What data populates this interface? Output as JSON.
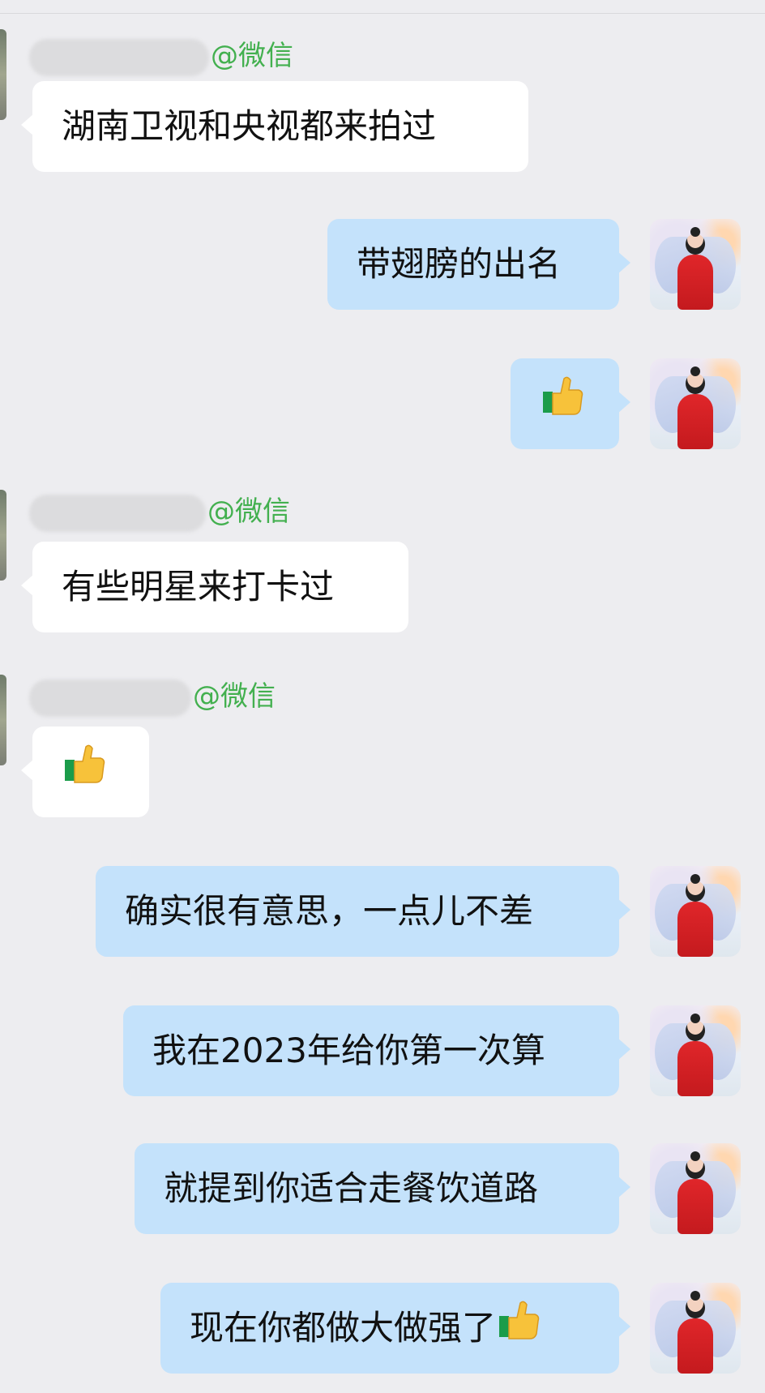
{
  "brand_color": "#43b04f",
  "bubble_colors": {
    "incoming": "#ffffff",
    "outgoing": "#c4e2fb"
  },
  "messages": [
    {
      "side": "left",
      "sender_suffix": "@微信",
      "text": "湖南卫视和央视都来拍过"
    },
    {
      "side": "right",
      "text": "带翅膀的出名"
    },
    {
      "side": "right",
      "emoji": "thumbs-up-icon"
    },
    {
      "side": "left",
      "sender_suffix": "@微信",
      "text": "有些明星来打卡过"
    },
    {
      "side": "left",
      "sender_suffix": "@微信",
      "emoji": "thumbs-up-icon"
    },
    {
      "side": "right",
      "text": "确实很有意思，一点儿不差"
    },
    {
      "side": "right",
      "text": "我在2023年给你第一次算"
    },
    {
      "side": "right",
      "text": "就提到你适合走餐饮道路"
    },
    {
      "side": "right",
      "text": "现在你都做大做强了",
      "emoji": "thumbs-up-icon"
    }
  ]
}
